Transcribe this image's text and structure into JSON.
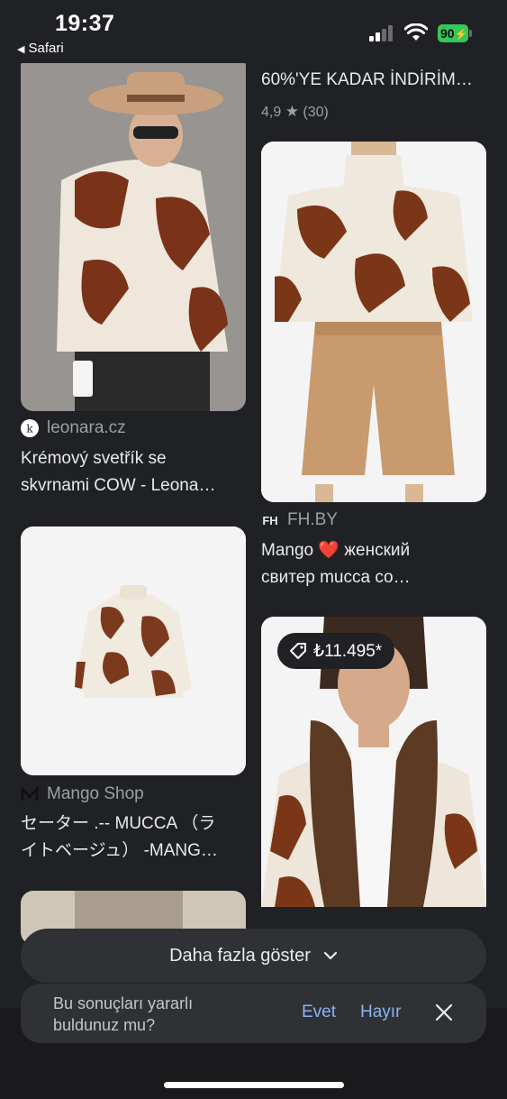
{
  "status_bar": {
    "time": "19:37",
    "back_label": "Safari",
    "battery": "90",
    "icons": [
      "cellular-signal-icon",
      "wifi-icon",
      "battery-charging-icon"
    ]
  },
  "results": {
    "left": [
      {
        "source": "leonara.cz",
        "title_line1": "Krémový svetřík se",
        "title_line2": "skvrnami COW - Leona…"
      },
      {
        "source": "Mango Shop",
        "title_line1": "セーター .-- MUCCA （ラ",
        "title_line2": "イトベージュ） -MANG…"
      }
    ],
    "right": [
      {
        "title_line1": "60%'YE KADAR İNDİRİM…",
        "rating": "4,9",
        "review_count": "(30)"
      },
      {
        "source": "FH.BY",
        "title_line1": "Mango ❤️ женский",
        "title_line2": "свитер mucca со…"
      },
      {
        "price": "₺11.495*"
      }
    ]
  },
  "more_button": {
    "label": "Daha fazla göster"
  },
  "feedback": {
    "question": "Bu sonuçları yararlı bulduNUZ mu?",
    "question_display": "Bu sonuçları yararlı buldunuz mu?",
    "yes_label": "Evet",
    "no_label": "Hayır"
  },
  "colors": {
    "background": "#202124",
    "link": "#8ab4f8",
    "battery": "#34c759"
  }
}
